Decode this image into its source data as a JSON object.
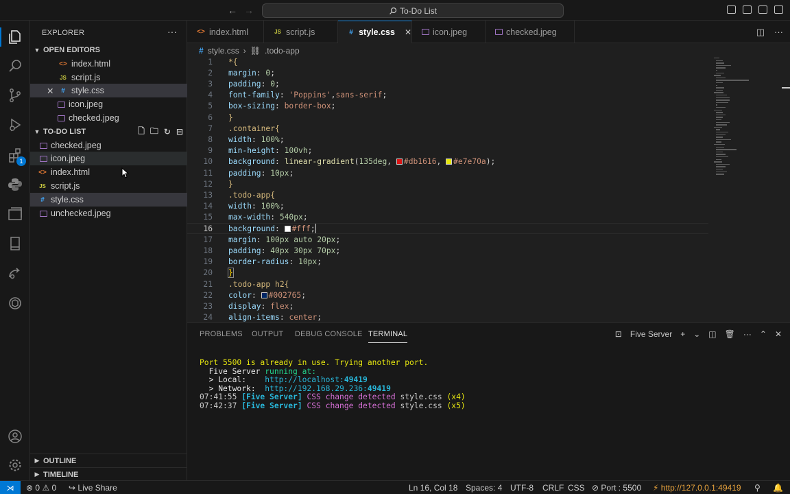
{
  "window": {
    "title": "To-Do List"
  },
  "sidebar": {
    "title": "EXPLORER",
    "open_editors_label": "OPEN EDITORS",
    "open_editors": [
      {
        "name": "index.html",
        "kind": "html"
      },
      {
        "name": "script.js",
        "kind": "js"
      },
      {
        "name": "style.css",
        "kind": "css"
      },
      {
        "name": "icon.jpeg",
        "kind": "img"
      },
      {
        "name": "checked.jpeg",
        "kind": "img"
      }
    ],
    "project_label": "TO-DO LIST",
    "files": [
      {
        "name": "checked.jpeg",
        "kind": "img"
      },
      {
        "name": "icon.jpeg",
        "kind": "img"
      },
      {
        "name": "index.html",
        "kind": "html"
      },
      {
        "name": "script.js",
        "kind": "js"
      },
      {
        "name": "style.css",
        "kind": "css"
      },
      {
        "name": "unchecked.jpeg",
        "kind": "img"
      }
    ],
    "outline_label": "OUTLINE",
    "timeline_label": "TIMELINE"
  },
  "activity": {
    "extensions_badge": "1"
  },
  "tabs": [
    {
      "name": "index.html",
      "icon": "<>"
    },
    {
      "name": "script.js",
      "icon": "JS"
    },
    {
      "name": "style.css",
      "icon": "#"
    },
    {
      "name": "icon.jpeg",
      "icon": "img"
    },
    {
      "name": "checked.jpeg",
      "icon": "img"
    }
  ],
  "breadcrumb": {
    "file": "style.css",
    "symbol": ".todo-app"
  },
  "editor": {
    "line_numbers": [
      "1",
      "2",
      "3",
      "4",
      "5",
      "6",
      "7",
      "8",
      "9",
      "10",
      "11",
      "12",
      "13",
      "14",
      "15",
      "16",
      "17",
      "18",
      "19",
      "20",
      "21",
      "22",
      "23",
      "24"
    ],
    "current_line": "16",
    "code": {
      "l1": "*{",
      "l2_prop": "margin",
      "l2_val": "0",
      "l3_prop": "padding",
      "l3_val": "0",
      "l4_prop": "font-family",
      "l4_str": "'Poppins'",
      "l4_rest": "sans-serif",
      "l5_prop": "box-sizing",
      "l5_val": "border-box",
      "l6": "}",
      "l7": ".container{",
      "l8_prop": "width",
      "l8_val": "100%",
      "l9_prop": "min-height",
      "l9_val": "100vh",
      "l10_prop": "background",
      "l10_fn": "linear-gradient",
      "l10_deg": "135deg",
      "l10_c1": "#db1616",
      "l10_c2": "#e7e70a",
      "l11_prop": "padding",
      "l11_val": "10px",
      "l12": "}",
      "l13": ".todo-app{",
      "l14_prop": "width",
      "l14_val": "100%",
      "l15_prop": "max-width",
      "l15_val": "540px",
      "l16_prop": "background",
      "l16_val": "#fff",
      "l17_prop": "margin",
      "l17_val": "100px auto 20px",
      "l18_prop": "padding",
      "l18_val": "40px 30px 70px",
      "l19_prop": "border-radius",
      "l19_val": "10px",
      "l20": "}",
      "l21": ".todo-app h2{",
      "l22_prop": "color",
      "l22_val": "#002765",
      "l23_prop": "display",
      "l23_val": "flex",
      "l24_prop": "align-items",
      "l24_val": "center"
    }
  },
  "panel": {
    "tabs": [
      "PROBLEMS",
      "OUTPUT",
      "DEBUG CONSOLE",
      "TERMINAL"
    ],
    "terminal_name": "Five Server",
    "lines": {
      "t1": "Port 5500 is already in use. Trying another port.",
      "t2_a": "  Five Server",
      "t2_b": " running at:",
      "t3_a": "  > Local:    ",
      "t3_b": "http://localhost:",
      "t3_c": "49419",
      "t4_a": "  > Network:  ",
      "t4_b": "http://192.168.29.236:",
      "t4_c": "49419",
      "t5_time": "07:41:55",
      "t5_tag": " [Five Server]",
      "t5_msg": " CSS change detected",
      "t5_file": " style.css",
      "t5_cnt": " (x4)",
      "t6_time": "07:42:37",
      "t6_tag": " [Five Server]",
      "t6_msg": " CSS change detected",
      "t6_file": " style.css",
      "t6_cnt": " (x5)"
    }
  },
  "statusbar": {
    "errors": "0",
    "warnings": "0",
    "live_share": "Live Share",
    "position": "Ln 16, Col 18",
    "spaces": "Spaces: 4",
    "encoding": "UTF-8",
    "eol": "CRLF",
    "language": "CSS",
    "port": "Port : 5500",
    "url": "http://127.0.0.1:49419"
  },
  "colors": {
    "accent": "#0078d4",
    "swatch_red": "#db1616",
    "swatch_yellow": "#e7e70a",
    "swatch_white": "#ffffff",
    "swatch_navy": "#002765"
  }
}
